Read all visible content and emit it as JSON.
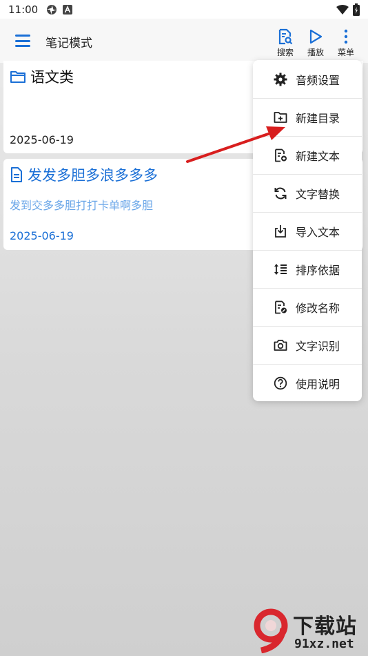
{
  "status_bar": {
    "time": "11:00",
    "icons": [
      "app-icon",
      "a-badge-icon",
      "wifi-icon",
      "battery-icon"
    ]
  },
  "app_bar": {
    "title": "笔记模式",
    "actions": [
      {
        "label": "搜索",
        "icon": "search-doc-icon"
      },
      {
        "label": "播放",
        "icon": "play-icon"
      },
      {
        "label": "菜单",
        "icon": "more-vert-icon"
      }
    ],
    "accent_color": "#1a6fd6"
  },
  "notes": [
    {
      "type": "folder",
      "icon": "folder-icon",
      "title": "语文类",
      "preview": "",
      "date": "2025-06-19"
    },
    {
      "type": "document",
      "icon": "document-icon",
      "title": "发发多胆多浪多多多",
      "preview": "发到交多多胆打打卡单啊多胆",
      "date": "2025-06-19"
    }
  ],
  "menu": {
    "items": [
      {
        "label": "音频设置",
        "icon": "gear-icon"
      },
      {
        "label": "新建目录",
        "icon": "new-folder-icon"
      },
      {
        "label": "新建文本",
        "icon": "new-file-icon"
      },
      {
        "label": "文字替换",
        "icon": "refresh-icon"
      },
      {
        "label": "导入文本",
        "icon": "import-icon"
      },
      {
        "label": "排序依据",
        "icon": "sort-icon"
      },
      {
        "label": "修改名称",
        "icon": "edit-file-icon"
      },
      {
        "label": "文字识别",
        "icon": "camera-icon"
      },
      {
        "label": "使用说明",
        "icon": "help-icon"
      }
    ]
  },
  "annotation": {
    "color": "#d81e1e"
  },
  "watermark": {
    "line1": "下载站",
    "line2": "91xz.net",
    "logo_text": "9"
  }
}
